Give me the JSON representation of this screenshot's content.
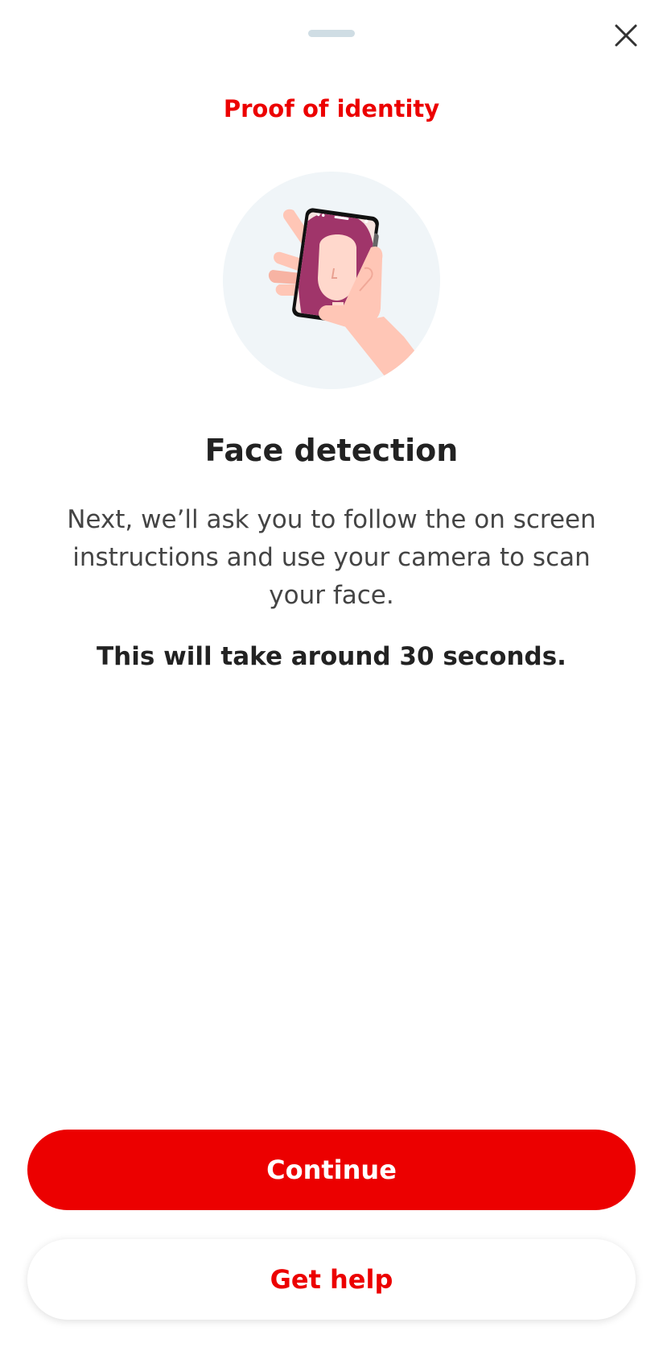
{
  "header": {
    "title": "Proof of identity",
    "close_icon": "close-icon"
  },
  "illustration": {
    "icon": "face-scan-phone-illustration"
  },
  "content": {
    "headline": "Face detection",
    "description": "Next, we’ll ask you to follow the on screen instructions and use your camera to scan your face.",
    "duration_note": "This will take around 30 seconds."
  },
  "actions": {
    "continue_label": "Continue",
    "help_label": "Get help"
  },
  "colors": {
    "brand": "#ec0000",
    "illustration_bg": "#f0f5f8",
    "hair": "#a0356a",
    "skin": "#ffc6b6"
  }
}
